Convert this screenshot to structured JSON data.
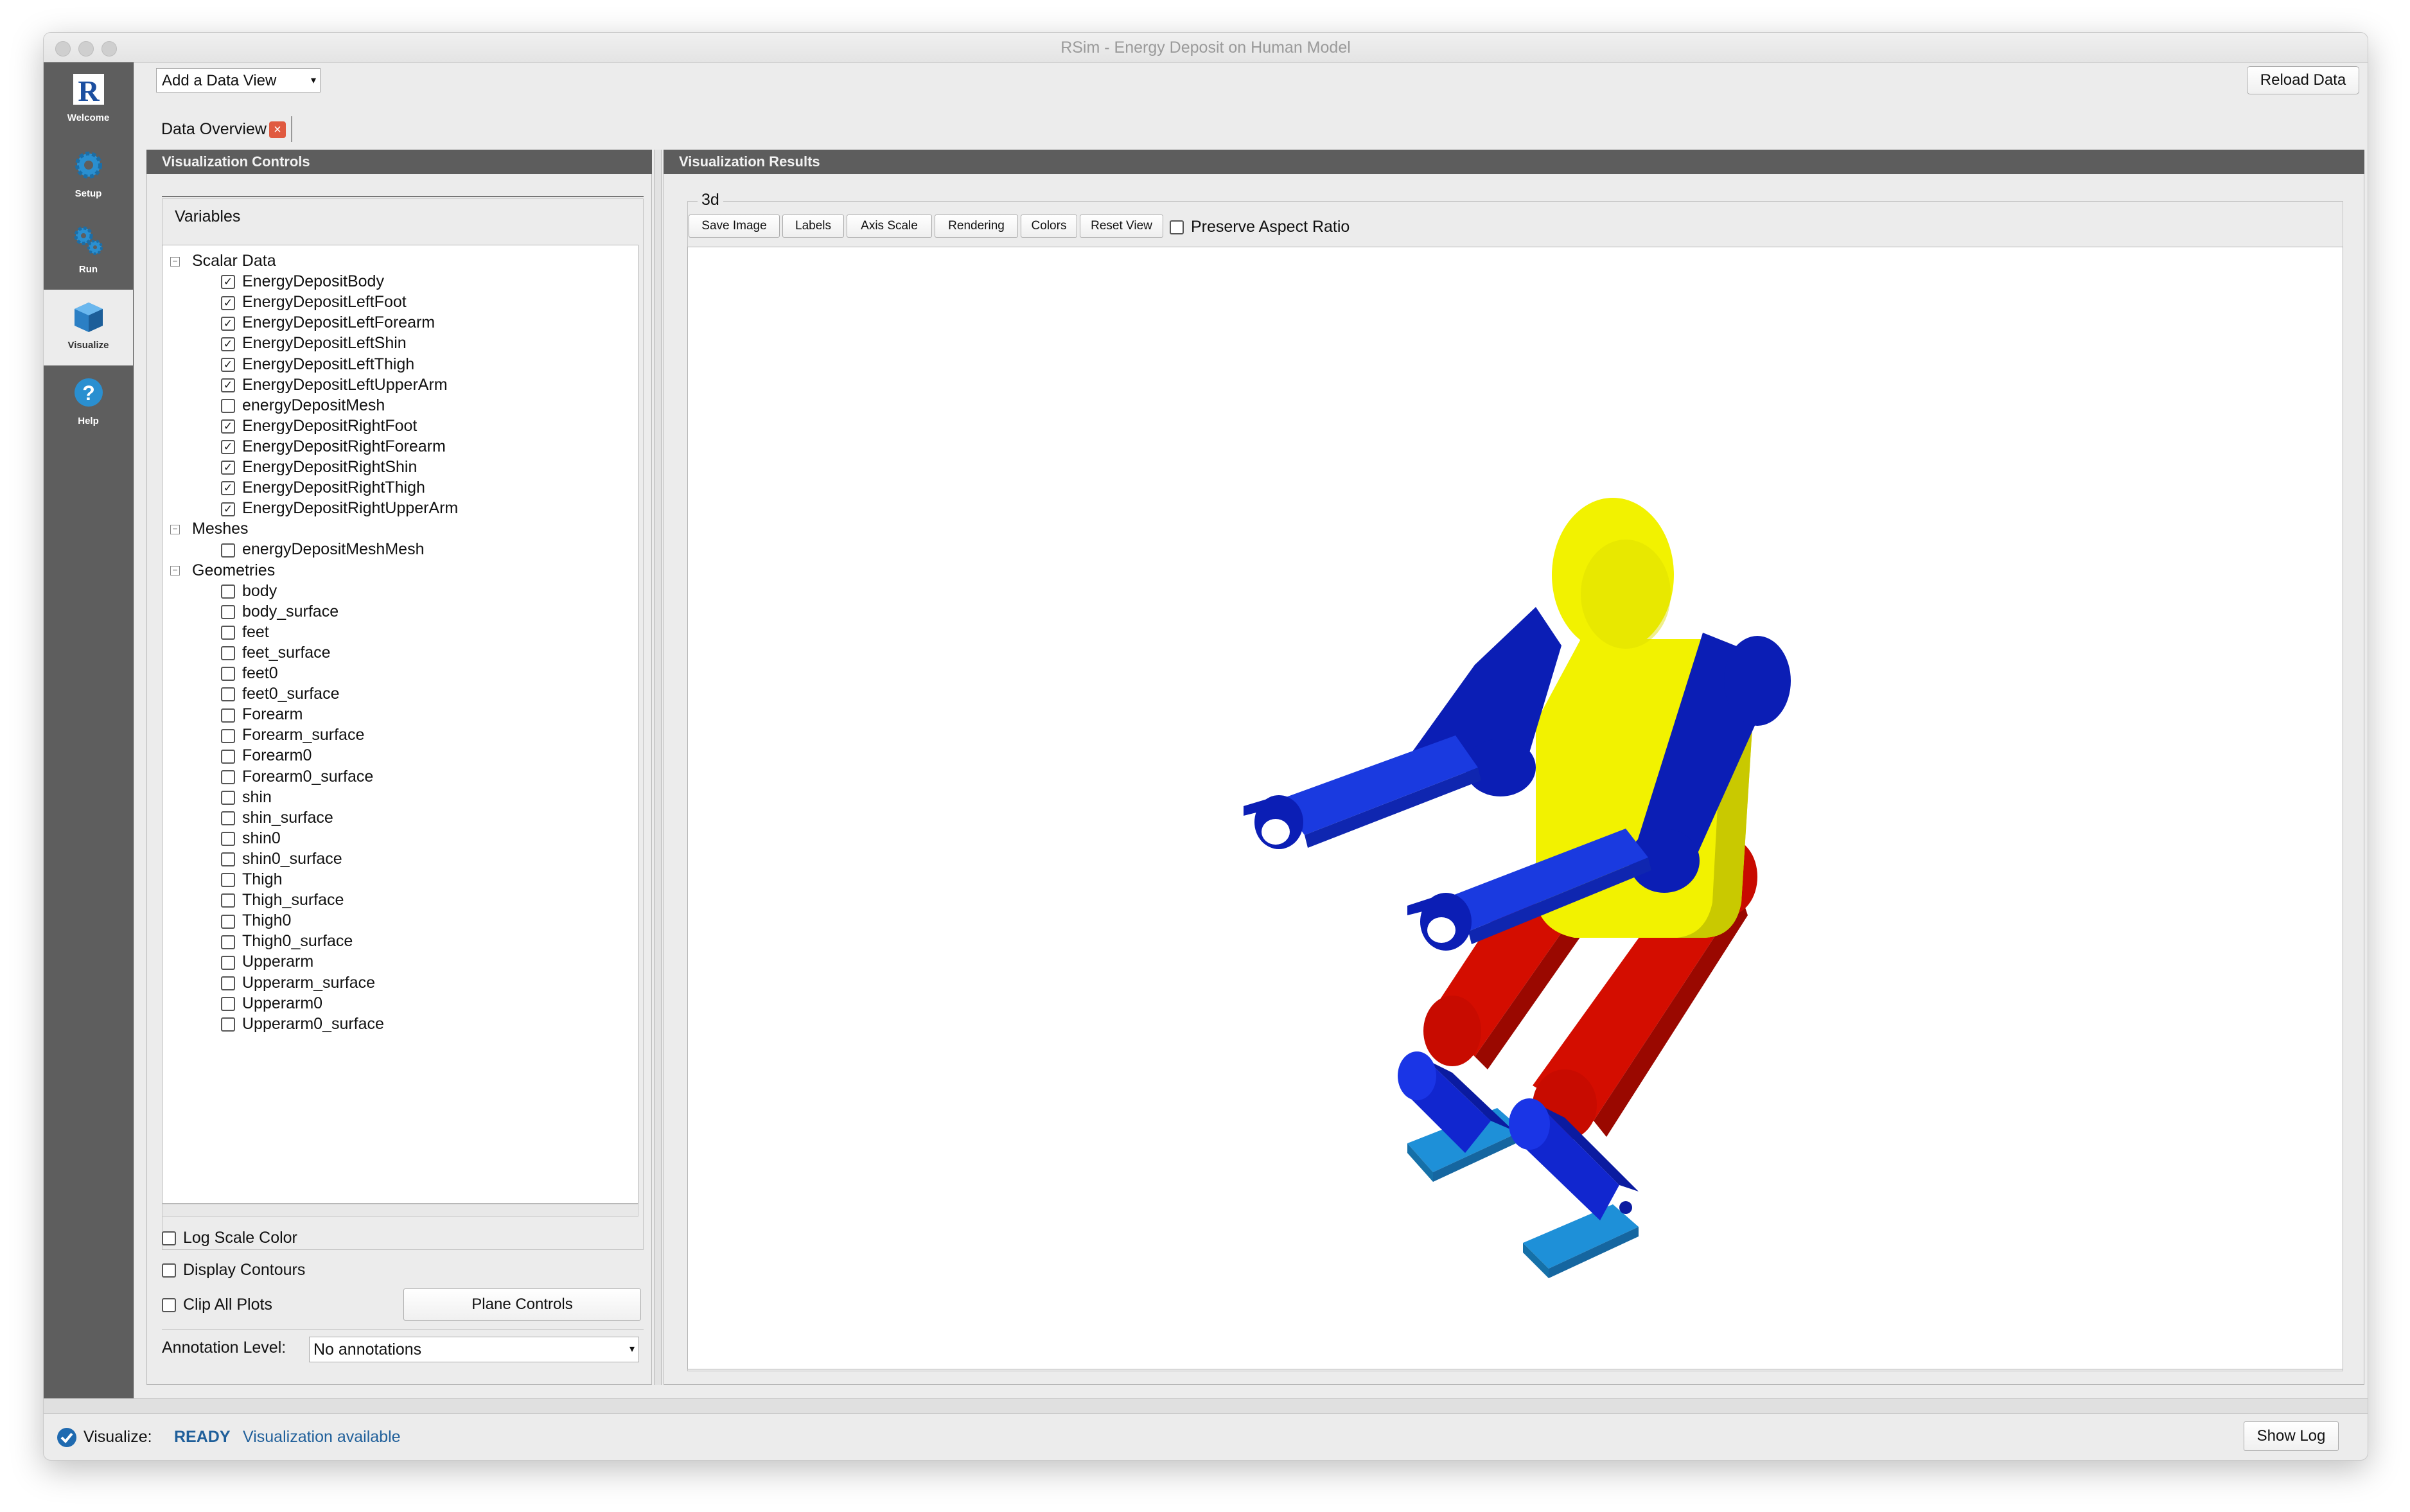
{
  "window": {
    "title": "RSim - Energy Deposit on Human Model"
  },
  "sidebar": {
    "items": [
      {
        "label": "Welcome",
        "icon": "app-logo-icon"
      },
      {
        "label": "Setup",
        "icon": "gear-icon"
      },
      {
        "label": "Run",
        "icon": "gears-icon"
      },
      {
        "label": "Visualize",
        "icon": "cube-icon",
        "active": true
      },
      {
        "label": "Help",
        "icon": "help-icon"
      }
    ]
  },
  "toolbar": {
    "add_data_view": "Add a Data View",
    "reload_data": "Reload Data"
  },
  "tab": {
    "label": "Data Overview"
  },
  "controls": {
    "header": "Visualization Controls",
    "variables_label": "Variables",
    "tree": {
      "scalar_group": "Scalar Data",
      "scalar_items": [
        {
          "label": "EnergyDepositBody",
          "checked": true
        },
        {
          "label": "EnergyDepositLeftFoot",
          "checked": true
        },
        {
          "label": "EnergyDepositLeftForearm",
          "checked": true
        },
        {
          "label": "EnergyDepositLeftShin",
          "checked": true
        },
        {
          "label": "EnergyDepositLeftThigh",
          "checked": true
        },
        {
          "label": "EnergyDepositLeftUpperArm",
          "checked": true
        },
        {
          "label": "energyDepositMesh",
          "checked": false
        },
        {
          "label": "EnergyDepositRightFoot",
          "checked": true
        },
        {
          "label": "EnergyDepositRightForearm",
          "checked": true
        },
        {
          "label": "EnergyDepositRightShin",
          "checked": true
        },
        {
          "label": "EnergyDepositRightThigh",
          "checked": true
        },
        {
          "label": "EnergyDepositRightUpperArm",
          "checked": true
        }
      ],
      "mesh_group": "Meshes",
      "mesh_items": [
        {
          "label": "energyDepositMeshMesh",
          "checked": false
        }
      ],
      "geometry_group": "Geometries",
      "geometry_items": [
        {
          "label": "body",
          "checked": false
        },
        {
          "label": "body_surface",
          "checked": false
        },
        {
          "label": "feet",
          "checked": false
        },
        {
          "label": "feet_surface",
          "checked": false
        },
        {
          "label": "feet0",
          "checked": false
        },
        {
          "label": "feet0_surface",
          "checked": false
        },
        {
          "label": "Forearm",
          "checked": false
        },
        {
          "label": "Forearm_surface",
          "checked": false
        },
        {
          "label": "Forearm0",
          "checked": false
        },
        {
          "label": "Forearm0_surface",
          "checked": false
        },
        {
          "label": "shin",
          "checked": false
        },
        {
          "label": "shin_surface",
          "checked": false
        },
        {
          "label": "shin0",
          "checked": false
        },
        {
          "label": "shin0_surface",
          "checked": false
        },
        {
          "label": "Thigh",
          "checked": false
        },
        {
          "label": "Thigh_surface",
          "checked": false
        },
        {
          "label": "Thigh0",
          "checked": false
        },
        {
          "label": "Thigh0_surface",
          "checked": false
        },
        {
          "label": "Upperarm",
          "checked": false
        },
        {
          "label": "Upperarm_surface",
          "checked": false
        },
        {
          "label": "Upperarm0",
          "checked": false
        },
        {
          "label": "Upperarm0_surface",
          "checked": false
        }
      ]
    },
    "options": [
      {
        "label": "Log Scale Color",
        "checked": false
      },
      {
        "label": "Display Contours",
        "checked": false
      },
      {
        "label": "Clip All Plots",
        "checked": false
      }
    ],
    "plane_controls": "Plane Controls",
    "annotation_label": "Annotation Level:",
    "annotation_value": "No annotations"
  },
  "results": {
    "header": "Visualization Results",
    "view_label": "3d",
    "buttons": [
      "Save Image",
      "Labels",
      "Axis Scale",
      "Rendering",
      "Colors",
      "Reset View"
    ],
    "preserve_aspect": {
      "label": "Preserve Aspect Ratio",
      "checked": false
    }
  },
  "status": {
    "module": "Visualize:",
    "state": "READY",
    "message": "Visualization available",
    "show_log": "Show Log"
  },
  "colors": {
    "head_body": "#f2f200",
    "upper_arm": "#0b1eb5",
    "forearm": "#1a3ae0",
    "thigh": "#d40d00",
    "shin": "#1126cf",
    "foot": "#1e90d8",
    "status_accent": "#1f5f9a"
  }
}
